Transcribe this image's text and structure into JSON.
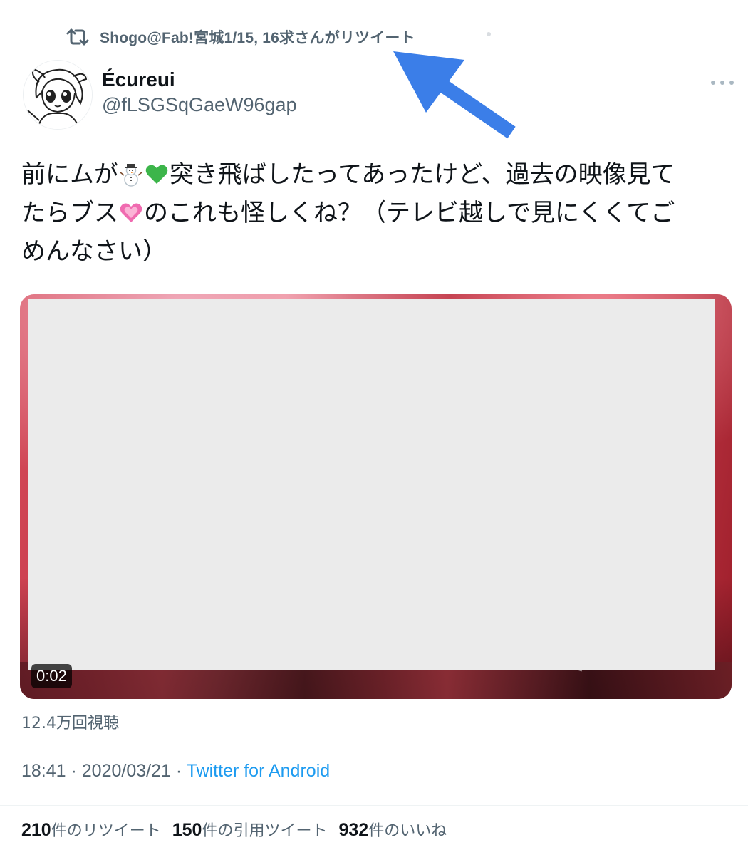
{
  "retweet_banner": {
    "icon": "retweet-icon",
    "text": "Shogo@Fab!宮城1/15, 16求さんがリツイート"
  },
  "annotation": {
    "type": "arrow",
    "color": "#3b7ee8"
  },
  "author": {
    "name": "Écureui",
    "handle": "@fLSGSqGaeW96gap",
    "avatar_icon": "manga-girl-avatar"
  },
  "tweet": {
    "line1_a": "前にムが",
    "emoji_1": "snowman-emoji",
    "emoji_2": "green-heart-emoji",
    "line1_b": "突き飛ばしたってあったけど、過去の映像見て",
    "line2_a": "たらブス",
    "emoji_3": "pink-heart-emoji",
    "line2_b": "のこれも怪しくね？（テレビ越しで見にくくてご",
    "line3": "めんなさい）"
  },
  "media": {
    "type": "video",
    "duration": "0:02",
    "views": "12.4万回視聴"
  },
  "meta": {
    "time": "18:41",
    "separator": " · ",
    "date": "2020/03/21",
    "source": "Twitter for Android"
  },
  "stats": [
    {
      "count": "210",
      "label": "件のリツイート"
    },
    {
      "count": "150",
      "label": "件の引用ツイート"
    },
    {
      "count": "932",
      "label": "件のいいね"
    }
  ],
  "colors": {
    "text_primary": "#0f1419",
    "text_secondary": "#536471",
    "link": "#1d9bf0",
    "arrow": "#3b7ee8"
  }
}
